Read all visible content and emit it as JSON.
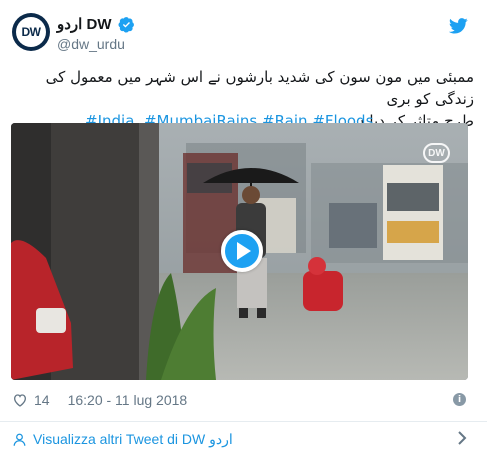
{
  "tweet": {
    "display_name": "DW اردو",
    "handle": "@dw_urdu",
    "avatar_label": "DW",
    "text_line1": "ممبئی میں مون سون کی شدید بارشوں نے اس شہر میں معمول کی زندگی کو بری",
    "text_line2": "طرح متاثر کر دیا ہے۔",
    "hashtags": [
      "#India",
      "#MumbaiRains",
      "#Rain",
      "#Floods"
    ],
    "media": {
      "watermark": "DW",
      "play_icon": "play-icon"
    },
    "likes": "14",
    "timestamp": "16:20 - 11 lug 2018"
  },
  "footer": {
    "link_label": "Visualizza altri Tweet di DW اردو"
  },
  "colors": {
    "link": "#1b95e0",
    "play": "#1da1f2",
    "muted": "#657786",
    "text": "#14171a",
    "divider": "#e6ecf0"
  },
  "icons": [
    "verified-badge-icon",
    "twitter-bird-icon",
    "heart-icon",
    "info-icon",
    "person-icon",
    "chevron-right-icon"
  ]
}
